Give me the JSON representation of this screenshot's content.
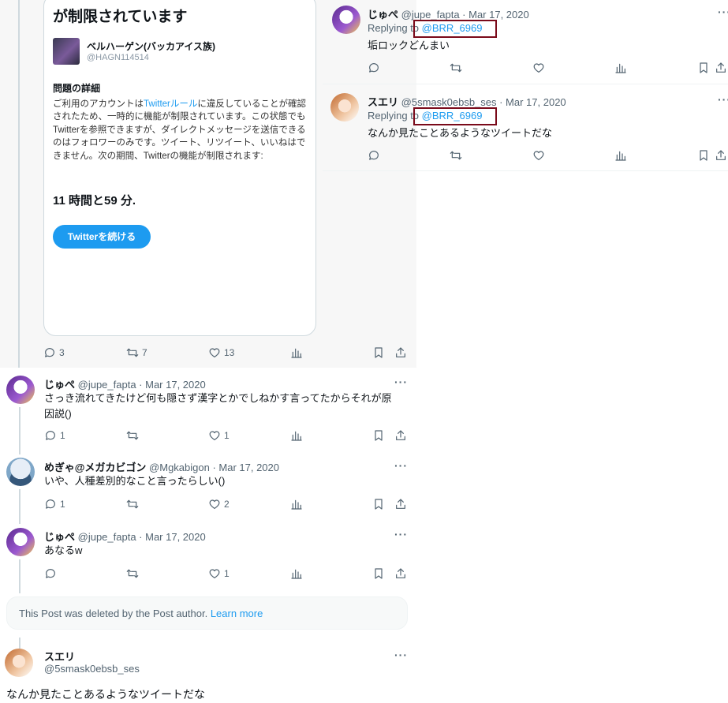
{
  "card": {
    "title": "が制限されています",
    "account_name": "ベルハーゲン(バッカアイス族)",
    "account_handle": "@HAGN114514",
    "section_title": "問題の詳細",
    "body_pre": "ご利用のアカウントは",
    "body_link": "Twitterルール",
    "body_post": "に違反していることが確認されたため、一時的に機能が制限されています。この状態でもTwitterを参照できますが、ダイレクトメッセージを送信できるのはフォロワーのみです。ツイート、リツイート、いいねはできません。次の期間、Twitterの機能が制限されます:",
    "time_left": "11 時間と59 分.",
    "continue_button": "Twitterを続ける",
    "reply_count": "3",
    "retweet_count": "7",
    "like_count": "13"
  },
  "left_thread": [
    {
      "name": "じゅぺ",
      "meta": "@jupe_fapta · Mar 17, 2020",
      "text_line1": "さっき流れてきたけど何も隠さず漢字とかでしねかす言ってたからそれが原",
      "text_line2": "因説()",
      "reply_count": "1",
      "retweet_count": "",
      "like_count": "1"
    },
    {
      "name": "めぎゃ@メガカビゴン",
      "meta": "@Mgkabigon · Mar 17, 2020",
      "text_line1": "いや、人種差別的なこと言ったらしい()",
      "reply_count": "1",
      "retweet_count": "",
      "like_count": "2"
    },
    {
      "name": "じゅぺ",
      "meta": "@jupe_fapta · Mar 17, 2020",
      "text_line1": "あなるw",
      "reply_count": "",
      "retweet_count": "",
      "like_count": "1"
    }
  ],
  "deleted": {
    "text": "This Post was deleted by the Post author.",
    "link": "Learn more"
  },
  "main_post": {
    "name": "スエリ",
    "handle": "@5smask0ebsb_ses",
    "text": "なんか見たことあるようなツイートだな"
  },
  "right_replies": [
    {
      "name": "じゅぺ",
      "meta": "@jupe_fapta · Mar 17, 2020",
      "replying_prefix": "Replying to",
      "replying_handle": "@BRR_6969",
      "text": "垢ロックどんまい"
    },
    {
      "name": "スエリ",
      "meta": "@5smask0ebsb_ses · Mar 17, 2020",
      "replying_prefix": "Replying to",
      "replying_handle": "@BRR_6969",
      "text": "なんか見たことあるようなツイートだな"
    }
  ],
  "more_glyph": "···",
  "colors": {
    "accent": "#1d9bf0",
    "highlight_box": "#7a0a1a",
    "muted_text": "#536471"
  },
  "icons": [
    "reply-icon",
    "retweet-icon",
    "like-icon",
    "views-icon",
    "bookmark-icon",
    "share-icon",
    "more-icon"
  ]
}
